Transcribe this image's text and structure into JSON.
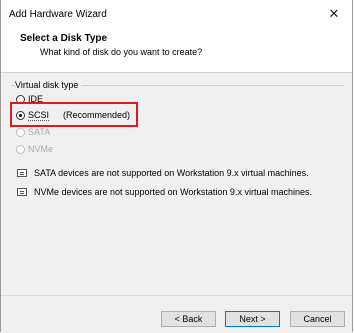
{
  "window": {
    "title": "Add Hardware Wizard",
    "close_glyph": "✕"
  },
  "header": {
    "title": "Select a Disk Type",
    "subtitle": "What kind of disk do you want to create?"
  },
  "group": {
    "label": "Virtual disk type",
    "options": [
      {
        "label": "IDE",
        "selected": false,
        "enabled": true
      },
      {
        "label": "SCSI",
        "selected": true,
        "enabled": true,
        "suffix": "(Recommended)"
      },
      {
        "label": "SATA",
        "selected": false,
        "enabled": false
      },
      {
        "label": "NVMe",
        "selected": false,
        "enabled": false
      }
    ]
  },
  "notes": [
    "SATA devices are not supported on Workstation 9.x virtual machines.",
    "NVMe devices are not supported on Workstation 9.x virtual machines."
  ],
  "footer": {
    "back_label": "< Back",
    "next_label": "Next >",
    "cancel_label": "Cancel"
  },
  "colors": {
    "highlight": "#e3181f",
    "default_button_border": "#0078d7"
  }
}
